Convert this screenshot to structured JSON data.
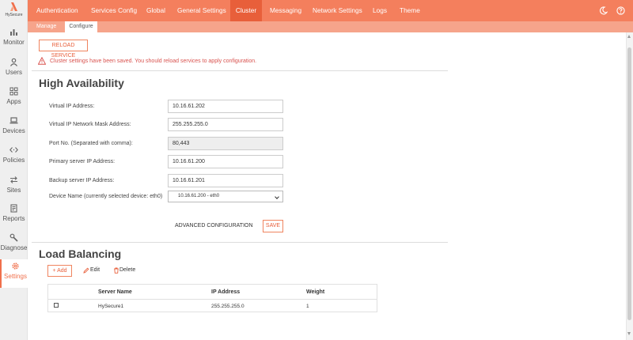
{
  "app": {
    "logo_text": "HySecure"
  },
  "sidebar": {
    "items": [
      {
        "label": "Monitor",
        "icon": "bar-chart-icon"
      },
      {
        "label": "Users",
        "icon": "user-icon"
      },
      {
        "label": "Apps",
        "icon": "apps-grid-icon"
      },
      {
        "label": "Devices",
        "icon": "laptop-icon"
      },
      {
        "label": "Policies",
        "icon": "code-arrows-icon"
      },
      {
        "label": "Sites",
        "icon": "swap-arrows-icon"
      },
      {
        "label": "Reports",
        "icon": "document-icon"
      },
      {
        "label": "Diagnose",
        "icon": "wrench-icon"
      },
      {
        "label": "Settings",
        "icon": "gear-icon",
        "active": true
      }
    ]
  },
  "topnav": {
    "tabs": [
      {
        "label": "Authentication"
      },
      {
        "label": "Services Config"
      },
      {
        "label": "Global"
      },
      {
        "label": "General Settings"
      },
      {
        "label": "Cluster",
        "active": true
      },
      {
        "label": "Messaging"
      },
      {
        "label": "Network Settings"
      },
      {
        "label": "Logs"
      },
      {
        "label": "Theme"
      }
    ],
    "icons": [
      "moon-icon",
      "help-icon"
    ]
  },
  "subnav": {
    "tabs": [
      {
        "label": "Manage"
      },
      {
        "label": "Configure",
        "active": true
      }
    ]
  },
  "toolbar": {
    "reload_label": "RELOAD SERVICE"
  },
  "alert": {
    "message": "Cluster settings have been saved. You should reload services to apply configuration."
  },
  "ha": {
    "title": "High Availability",
    "fields": [
      {
        "label": "Virtual IP Address:",
        "value": "10.16.61.202"
      },
      {
        "label": "Virtual IP Network Mask Address:",
        "value": "255.255.255.0"
      },
      {
        "label": "Port No. (Separated with comma):",
        "value": "80,443"
      },
      {
        "label": "Primary server IP Address:",
        "value": "10.16.61.200"
      },
      {
        "label": "Backup server IP Address:",
        "value": "10.16.61.201"
      }
    ],
    "device": {
      "label": "Device Name (currently selected device: eth0)",
      "selected": "10.16.61.200 - eth0"
    },
    "advanced_label": "ADVANCED CONFIGURATION",
    "save_label": "SAVE"
  },
  "lb": {
    "title": "Load Balancing",
    "add_label": "+ Add",
    "edit_label": "Edit",
    "delete_label": "Delete",
    "columns": [
      "Server Name",
      "IP Address",
      "Weight"
    ],
    "rows": [
      {
        "server": "HySecure1",
        "ip": "255.255.255.0",
        "weight": "1"
      }
    ]
  },
  "colors": {
    "accent": "#f47f5d",
    "accent_dark": "#e85f3a",
    "error": "#d9534f"
  }
}
